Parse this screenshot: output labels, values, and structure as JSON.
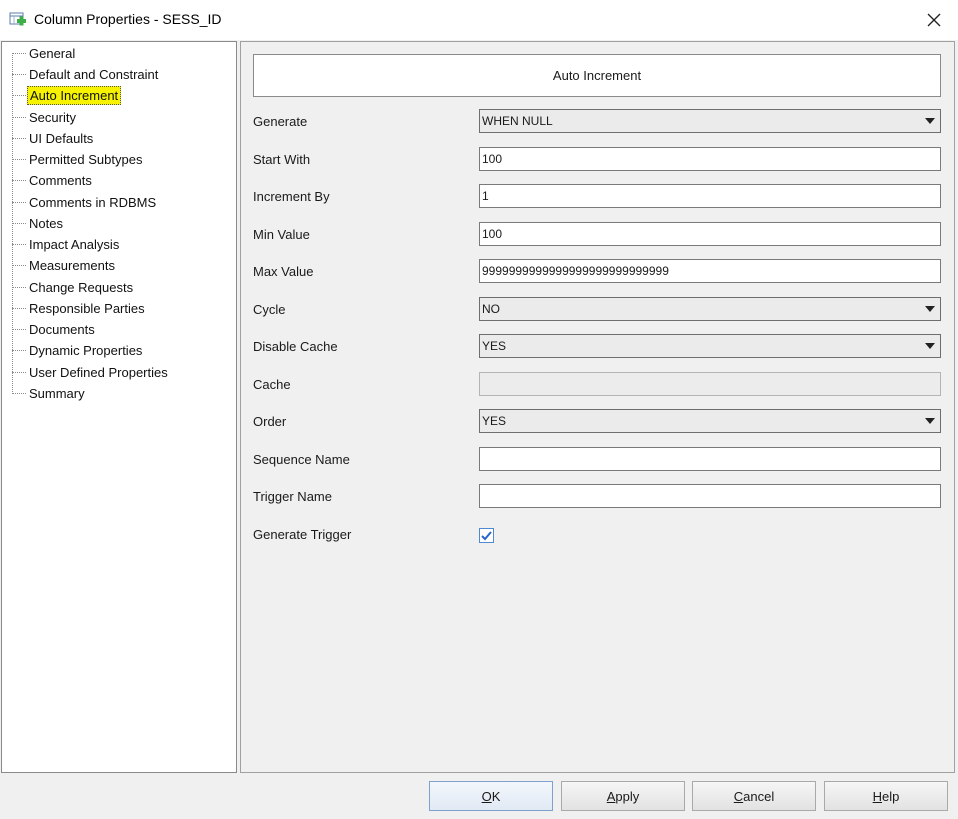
{
  "window": {
    "title": "Column Properties - SESS_ID",
    "close_symbol": "✕"
  },
  "tree": {
    "items": [
      {
        "label": "General"
      },
      {
        "label": "Default and Constraint"
      },
      {
        "label": "Auto Increment",
        "selected": true
      },
      {
        "label": "Security"
      },
      {
        "label": "UI Defaults"
      },
      {
        "label": "Permitted Subtypes"
      },
      {
        "label": "Comments"
      },
      {
        "label": "Comments in RDBMS"
      },
      {
        "label": "Notes"
      },
      {
        "label": "Impact Analysis"
      },
      {
        "label": "Measurements"
      },
      {
        "label": "Change Requests"
      },
      {
        "label": "Responsible Parties"
      },
      {
        "label": "Documents"
      },
      {
        "label": "Dynamic Properties"
      },
      {
        "label": "User Defined Properties"
      },
      {
        "label": "Summary"
      }
    ]
  },
  "panel": {
    "header": "Auto Increment",
    "fields": [
      {
        "label": "Generate",
        "type": "select",
        "value": "WHEN NULL"
      },
      {
        "label": "Start With",
        "type": "text",
        "value": "100"
      },
      {
        "label": "Increment By",
        "type": "text",
        "value": "1"
      },
      {
        "label": "Min Value",
        "type": "text",
        "value": "100"
      },
      {
        "label": "Max Value",
        "type": "text",
        "value": "9999999999999999999999999999"
      },
      {
        "label": "Cycle",
        "type": "select",
        "value": "NO"
      },
      {
        "label": "Disable Cache",
        "type": "select",
        "value": "YES"
      },
      {
        "label": "Cache",
        "type": "text",
        "value": "",
        "disabled": true
      },
      {
        "label": "Order",
        "type": "select",
        "value": "YES"
      },
      {
        "label": "Sequence Name",
        "type": "text",
        "value": ""
      },
      {
        "label": "Trigger Name",
        "type": "text",
        "value": ""
      },
      {
        "label": "Generate Trigger",
        "type": "checkbox",
        "checked": true
      }
    ]
  },
  "buttons": {
    "ok": {
      "mnemonic": "O",
      "rest": "K"
    },
    "apply": {
      "mnemonic": "A",
      "rest": "pply"
    },
    "cancel": {
      "mnemonic": "C",
      "rest": "ancel"
    },
    "help": {
      "mnemonic": "H",
      "rest": "elp"
    }
  },
  "colors": {
    "selection_highlight": "#f6f200",
    "checkbox_accent": "#2a66c4"
  }
}
